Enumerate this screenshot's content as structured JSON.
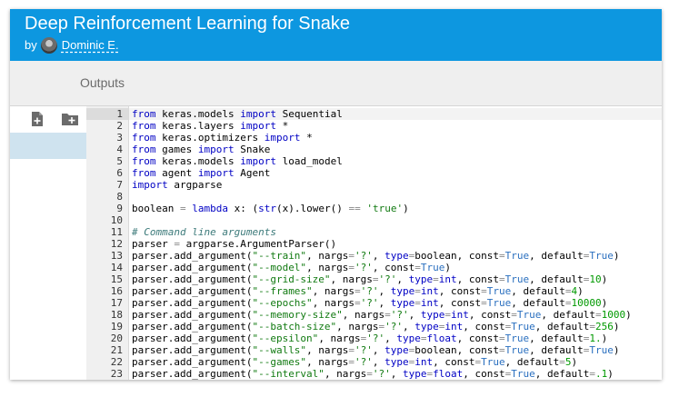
{
  "header": {
    "title": "Deep Reinforcement Learning for Snake",
    "by_label": "by",
    "author": "Dominic E."
  },
  "tabs": {
    "outputs_label": "Outputs"
  },
  "sidebar": {
    "tools": [
      {
        "icon": "new-file-icon"
      },
      {
        "icon": "new-folder-icon"
      }
    ]
  },
  "editor": {
    "active_line": 1,
    "lines": [
      [
        [
          "kw",
          "from"
        ],
        [
          "t",
          " keras.models "
        ],
        [
          "kw",
          "import"
        ],
        [
          "t",
          " Sequential"
        ]
      ],
      [
        [
          "kw",
          "from"
        ],
        [
          "t",
          " keras.layers "
        ],
        [
          "kw",
          "import"
        ],
        [
          "t",
          " *"
        ]
      ],
      [
        [
          "kw",
          "from"
        ],
        [
          "t",
          " keras.optimizers "
        ],
        [
          "kw",
          "import"
        ],
        [
          "t",
          " *"
        ]
      ],
      [
        [
          "kw",
          "from"
        ],
        [
          "t",
          " games "
        ],
        [
          "kw",
          "import"
        ],
        [
          "t",
          " Snake"
        ]
      ],
      [
        [
          "kw",
          "from"
        ],
        [
          "t",
          " keras.models "
        ],
        [
          "kw",
          "import"
        ],
        [
          "t",
          " load_model"
        ]
      ],
      [
        [
          "kw",
          "from"
        ],
        [
          "t",
          " agent "
        ],
        [
          "kw",
          "import"
        ],
        [
          "t",
          " Agent"
        ]
      ],
      [
        [
          "kw",
          "import"
        ],
        [
          "t",
          " argparse"
        ]
      ],
      [],
      [
        [
          "t",
          "boolean "
        ],
        [
          "op",
          "="
        ],
        [
          "t",
          " "
        ],
        [
          "kw",
          "lambda"
        ],
        [
          "t",
          " x: ("
        ],
        [
          "bi",
          "str"
        ],
        [
          "t",
          "(x).lower() "
        ],
        [
          "op",
          "=="
        ],
        [
          "t",
          " "
        ],
        [
          "str",
          "'true'"
        ],
        [
          "t",
          ")"
        ]
      ],
      [],
      [
        [
          "com",
          "# Command line arguments"
        ]
      ],
      [
        [
          "t",
          "parser "
        ],
        [
          "op",
          "="
        ],
        [
          "t",
          " argparse.ArgumentParser()"
        ]
      ],
      [
        [
          "t",
          "parser.add_argument("
        ],
        [
          "str",
          "\"--train\""
        ],
        [
          "t",
          ", nargs"
        ],
        [
          "op",
          "="
        ],
        [
          "str",
          "'?'"
        ],
        [
          "t",
          ", "
        ],
        [
          "arg",
          "type"
        ],
        [
          "op",
          "="
        ],
        [
          "t",
          "boolean, const"
        ],
        [
          "op",
          "="
        ],
        [
          "const",
          "True"
        ],
        [
          "t",
          ", default"
        ],
        [
          "op",
          "="
        ],
        [
          "const",
          "True"
        ],
        [
          "t",
          ")"
        ]
      ],
      [
        [
          "t",
          "parser.add_argument("
        ],
        [
          "str",
          "\"--model\""
        ],
        [
          "t",
          ", nargs"
        ],
        [
          "op",
          "="
        ],
        [
          "str",
          "'?'"
        ],
        [
          "t",
          ", const"
        ],
        [
          "op",
          "="
        ],
        [
          "const",
          "True"
        ],
        [
          "t",
          ")"
        ]
      ],
      [
        [
          "t",
          "parser.add_argument("
        ],
        [
          "str",
          "\"--grid-size\""
        ],
        [
          "t",
          ", nargs"
        ],
        [
          "op",
          "="
        ],
        [
          "str",
          "'?'"
        ],
        [
          "t",
          ", "
        ],
        [
          "arg",
          "type"
        ],
        [
          "op",
          "="
        ],
        [
          "bi",
          "int"
        ],
        [
          "t",
          ", const"
        ],
        [
          "op",
          "="
        ],
        [
          "const",
          "True"
        ],
        [
          "t",
          ", default"
        ],
        [
          "op",
          "="
        ],
        [
          "num",
          "10"
        ],
        [
          "t",
          ")"
        ]
      ],
      [
        [
          "t",
          "parser.add_argument("
        ],
        [
          "str",
          "\"--frames\""
        ],
        [
          "t",
          ", nargs"
        ],
        [
          "op",
          "="
        ],
        [
          "str",
          "'?'"
        ],
        [
          "t",
          ", "
        ],
        [
          "arg",
          "type"
        ],
        [
          "op",
          "="
        ],
        [
          "bi",
          "int"
        ],
        [
          "t",
          ", const"
        ],
        [
          "op",
          "="
        ],
        [
          "const",
          "True"
        ],
        [
          "t",
          ", default"
        ],
        [
          "op",
          "="
        ],
        [
          "num",
          "4"
        ],
        [
          "t",
          ")"
        ]
      ],
      [
        [
          "t",
          "parser.add_argument("
        ],
        [
          "str",
          "\"--epochs\""
        ],
        [
          "t",
          ", nargs"
        ],
        [
          "op",
          "="
        ],
        [
          "str",
          "'?'"
        ],
        [
          "t",
          ", "
        ],
        [
          "arg",
          "type"
        ],
        [
          "op",
          "="
        ],
        [
          "bi",
          "int"
        ],
        [
          "t",
          ", const"
        ],
        [
          "op",
          "="
        ],
        [
          "const",
          "True"
        ],
        [
          "t",
          ", default"
        ],
        [
          "op",
          "="
        ],
        [
          "num",
          "10000"
        ],
        [
          "t",
          ")"
        ]
      ],
      [
        [
          "t",
          "parser.add_argument("
        ],
        [
          "str",
          "\"--memory-size\""
        ],
        [
          "t",
          ", nargs"
        ],
        [
          "op",
          "="
        ],
        [
          "str",
          "'?'"
        ],
        [
          "t",
          ", "
        ],
        [
          "arg",
          "type"
        ],
        [
          "op",
          "="
        ],
        [
          "bi",
          "int"
        ],
        [
          "t",
          ", const"
        ],
        [
          "op",
          "="
        ],
        [
          "const",
          "True"
        ],
        [
          "t",
          ", default"
        ],
        [
          "op",
          "="
        ],
        [
          "num",
          "1000"
        ],
        [
          "t",
          ")"
        ]
      ],
      [
        [
          "t",
          "parser.add_argument("
        ],
        [
          "str",
          "\"--batch-size\""
        ],
        [
          "t",
          ", nargs"
        ],
        [
          "op",
          "="
        ],
        [
          "str",
          "'?'"
        ],
        [
          "t",
          ", "
        ],
        [
          "arg",
          "type"
        ],
        [
          "op",
          "="
        ],
        [
          "bi",
          "int"
        ],
        [
          "t",
          ", const"
        ],
        [
          "op",
          "="
        ],
        [
          "const",
          "True"
        ],
        [
          "t",
          ", default"
        ],
        [
          "op",
          "="
        ],
        [
          "num",
          "256"
        ],
        [
          "t",
          ")"
        ]
      ],
      [
        [
          "t",
          "parser.add_argument("
        ],
        [
          "str",
          "\"--epsilon\""
        ],
        [
          "t",
          ", nargs"
        ],
        [
          "op",
          "="
        ],
        [
          "str",
          "'?'"
        ],
        [
          "t",
          ", "
        ],
        [
          "arg",
          "type"
        ],
        [
          "op",
          "="
        ],
        [
          "bi",
          "float"
        ],
        [
          "t",
          ", const"
        ],
        [
          "op",
          "="
        ],
        [
          "const",
          "True"
        ],
        [
          "t",
          ", default"
        ],
        [
          "op",
          "="
        ],
        [
          "num",
          "1."
        ],
        [
          "t",
          ")"
        ]
      ],
      [
        [
          "t",
          "parser.add_argument("
        ],
        [
          "str",
          "\"--walls\""
        ],
        [
          "t",
          ", nargs"
        ],
        [
          "op",
          "="
        ],
        [
          "str",
          "'?'"
        ],
        [
          "t",
          ", "
        ],
        [
          "arg",
          "type"
        ],
        [
          "op",
          "="
        ],
        [
          "t",
          "boolean, const"
        ],
        [
          "op",
          "="
        ],
        [
          "const",
          "True"
        ],
        [
          "t",
          ", default"
        ],
        [
          "op",
          "="
        ],
        [
          "const",
          "True"
        ],
        [
          "t",
          ")"
        ]
      ],
      [
        [
          "t",
          "parser.add_argument("
        ],
        [
          "str",
          "\"--games\""
        ],
        [
          "t",
          ", nargs"
        ],
        [
          "op",
          "="
        ],
        [
          "str",
          "'?'"
        ],
        [
          "t",
          ", "
        ],
        [
          "arg",
          "type"
        ],
        [
          "op",
          "="
        ],
        [
          "bi",
          "int"
        ],
        [
          "t",
          ", const"
        ],
        [
          "op",
          "="
        ],
        [
          "const",
          "True"
        ],
        [
          "t",
          ", default"
        ],
        [
          "op",
          "="
        ],
        [
          "num",
          "5"
        ],
        [
          "t",
          ")"
        ]
      ],
      [
        [
          "t",
          "parser.add_argument("
        ],
        [
          "str",
          "\"--interval\""
        ],
        [
          "t",
          ", nargs"
        ],
        [
          "op",
          "="
        ],
        [
          "str",
          "'?'"
        ],
        [
          "t",
          ", "
        ],
        [
          "arg",
          "type"
        ],
        [
          "op",
          "="
        ],
        [
          "bi",
          "float"
        ],
        [
          "t",
          ", const"
        ],
        [
          "op",
          "="
        ],
        [
          "const",
          "True"
        ],
        [
          "t",
          ", default"
        ],
        [
          "op",
          "="
        ],
        [
          "num",
          ".1"
        ],
        [
          "t",
          ")"
        ]
      ]
    ]
  },
  "colors": {
    "header_bg": "#0d97e0",
    "keyword": "#0000c4",
    "string": "#117a11",
    "comment": "#3c7a7a"
  }
}
